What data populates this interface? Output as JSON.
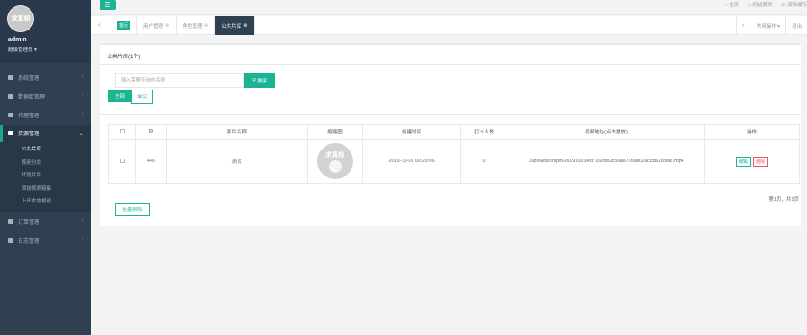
{
  "sidebar": {
    "avatar_text": "求真相",
    "username": "admin",
    "role": "超级管理员 ▾",
    "menu": [
      {
        "label": "系统管理",
        "icon": "gear-icon"
      },
      {
        "label": "数据库管理",
        "icon": "database-icon"
      },
      {
        "label": "代理管理",
        "icon": "users-icon"
      },
      {
        "label": "资源管理",
        "icon": "folder-icon"
      },
      {
        "label": "订单管理",
        "icon": "list-icon"
      },
      {
        "label": "日志管理",
        "icon": "list-icon"
      }
    ],
    "submenu": [
      "公共片库",
      "视频分类",
      "代理片库",
      "添加视频链接",
      "上传本地视频"
    ],
    "arrow": "‹",
    "arrow_open": "⌄"
  },
  "topbar": {
    "menu_glyph": "☰",
    "links": [
      "主页",
      "网站首页",
      "清除缓存"
    ]
  },
  "tabs": {
    "prev": "«",
    "home": "首页",
    "items": [
      "用户管理",
      "角色管理",
      "公共片库"
    ],
    "close": "⊗",
    "next": "»",
    "ops": "常用操作 ▾",
    "exit": "退出"
  },
  "main": {
    "title": "公共片库(1个)",
    "search_placeholder": "输入需要查询的名称",
    "search_label": "搜索",
    "filters": [
      "全部",
      "学习"
    ],
    "columns": [
      "",
      "ID",
      "影片名称",
      "缩略图",
      "创建时间",
      "打卡人数",
      "视频地址(点击播放)",
      "操作"
    ],
    "rows": [
      {
        "id": "446",
        "name": "测试",
        "thumb_text": "求真相",
        "created": "2019-10-01 00:20:06",
        "count": "0",
        "url": "./uploads/shipin/20191001/ed716dd82c50ae755ad02accba18bfab.mp4",
        "edit": "编辑",
        "del": "删除"
      }
    ],
    "pager": "第1页，共1页",
    "batch_delete": "批量删除"
  }
}
